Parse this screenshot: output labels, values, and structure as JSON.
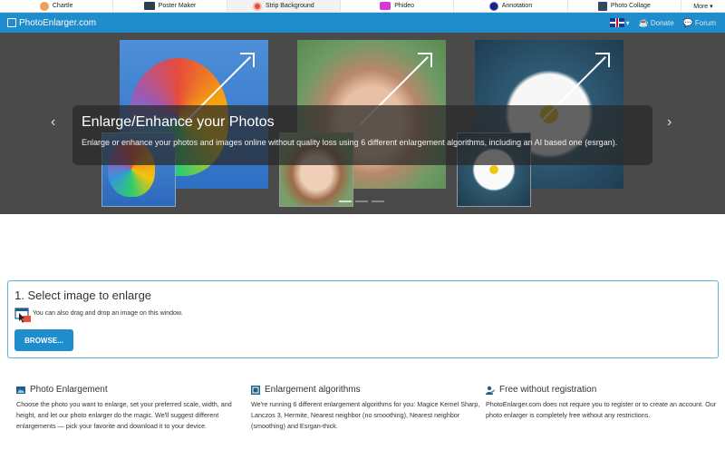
{
  "topbar": {
    "apps": [
      {
        "label": "Chartle",
        "icon": "chartle-icon",
        "color": "#e67e22"
      },
      {
        "label": "Poster Maker",
        "icon": "poster-maker-icon",
        "color": "#2c3e50"
      },
      {
        "label": "Strip Background",
        "icon": "strip-background-icon",
        "color": "#e74c3c"
      },
      {
        "label": "Phideo",
        "icon": "phideo-icon",
        "color": "#d63ad6"
      },
      {
        "label": "Annotation",
        "icon": "annotation-icon",
        "color": "#1a237e"
      },
      {
        "label": "Photo Collage",
        "icon": "photo-collage-icon",
        "color": "#34495e"
      },
      {
        "label": "More ▾",
        "icon": "",
        "color": ""
      }
    ]
  },
  "navbar": {
    "brand": "PhotoEnlarger.com",
    "language_caret": "▾",
    "donate": "Donate",
    "forum": "Forum"
  },
  "hero": {
    "title": "Enlarge/Enhance your Photos",
    "text": "Enlarge or enhance your photos and images online without quality loss using 6 different enlargement algorithms, including an AI based one (esrgan).",
    "prev": "‹",
    "next": "›",
    "active_slide": 1,
    "slide_count": 3
  },
  "select": {
    "title": "1. Select image to enlarge",
    "drag_text": "You can also drag and drop an image on this window.",
    "browse_label": "BROWSE..."
  },
  "features": [
    {
      "title": "Photo Enlargement",
      "icon": "image-icon",
      "text": "Choose the photo you want to enlarge, set your preferred scale, width, and height, and let our photo enlarger do the magic. We'll suggest different enlargements — pick your favorite and download it to your device."
    },
    {
      "title": "Enlargement algorithms",
      "icon": "algorithm-icon",
      "text": "We're running 6 different enlargement algorithms for you: Magice Kernel Sharp, Lanczos 3, Hermite, Nearest neighbor (no smoothing), Nearest neighbor (smoothing) and Esrgan-thick."
    },
    {
      "title": "Free without registration",
      "icon": "user-check-icon",
      "text": "PhotoEnlarger.com does not require you to register or to create an account. Our photo enlarger is completely free without any restrictions."
    }
  ],
  "colors": {
    "primary": "#1f8ccb",
    "hero_bg": "#4a4a4a"
  }
}
